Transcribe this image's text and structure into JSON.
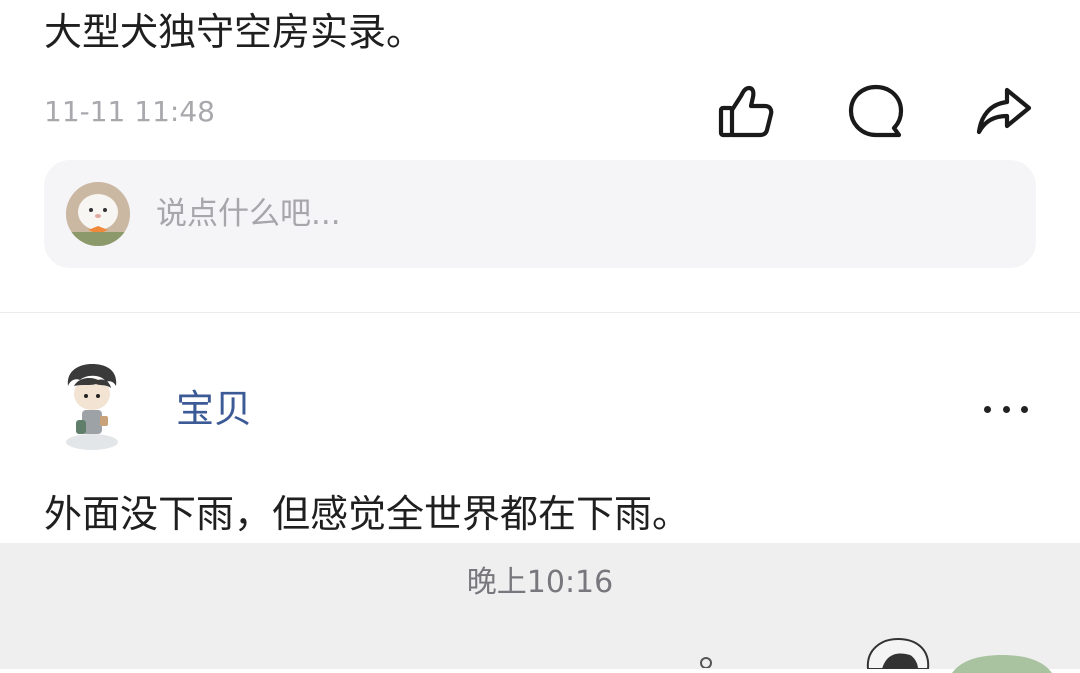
{
  "post": {
    "text": "大型犬独守空房实录。",
    "timestamp": "11-11 11:48"
  },
  "actions": {
    "like_icon": "thumbs-up-icon",
    "comment_icon": "speech-bubble-icon",
    "share_icon": "share-arrow-icon"
  },
  "comment_box": {
    "placeholder": "说点什么吧..."
  },
  "next_post": {
    "user_name": "宝贝",
    "text": "外面没下雨，但感觉全世界都在下雨。",
    "more_icon": "more-dots-icon"
  },
  "chat_footer": {
    "time": "晚上10:16"
  },
  "colors": {
    "name_link": "#3b5a96",
    "secondary_text": "#a8a8ad",
    "input_bg": "#f5f5f7",
    "bar_bg": "#efeff0"
  }
}
